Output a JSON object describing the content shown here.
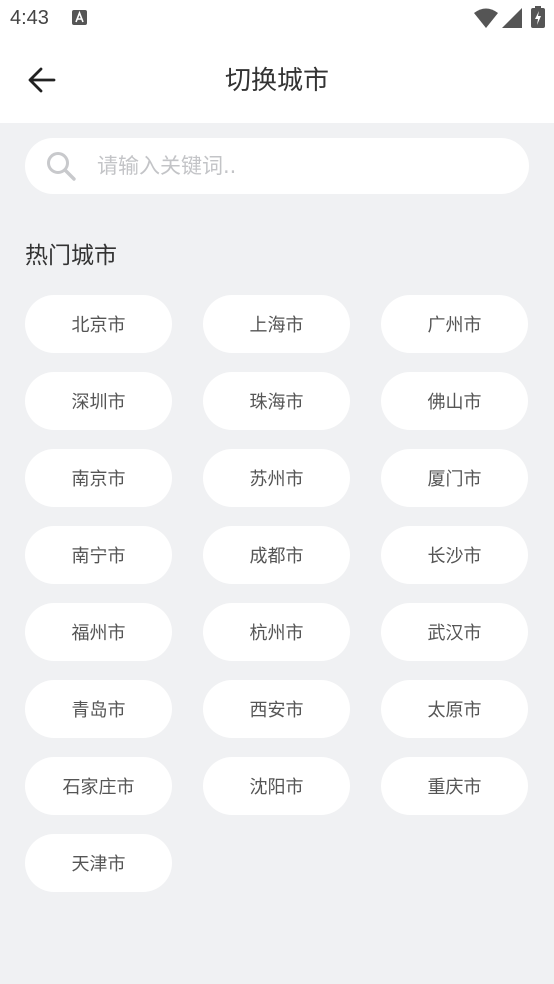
{
  "status_bar": {
    "time": "4:43",
    "icons": [
      "a-notification-icon",
      "wifi-icon",
      "signal-icon",
      "battery-icon"
    ]
  },
  "header": {
    "title": "切换城市",
    "back_icon": "arrow-left-icon"
  },
  "search": {
    "placeholder": "请输入关键词..",
    "value": "",
    "icon": "search-icon"
  },
  "hot_cities": {
    "title": "热门城市",
    "items": [
      "北京市",
      "上海市",
      "广州市",
      "深圳市",
      "珠海市",
      "佛山市",
      "南京市",
      "苏州市",
      "厦门市",
      "南宁市",
      "成都市",
      "长沙市",
      "福州市",
      "杭州市",
      "武汉市",
      "青岛市",
      "西安市",
      "太原市",
      "石家庄市",
      "沈阳市",
      "重庆市",
      "天津市"
    ]
  },
  "colors": {
    "background": "#f0f1f3",
    "surface": "#ffffff",
    "text_primary": "#333333",
    "text_chip": "#555555",
    "placeholder": "#c3c4c7"
  }
}
